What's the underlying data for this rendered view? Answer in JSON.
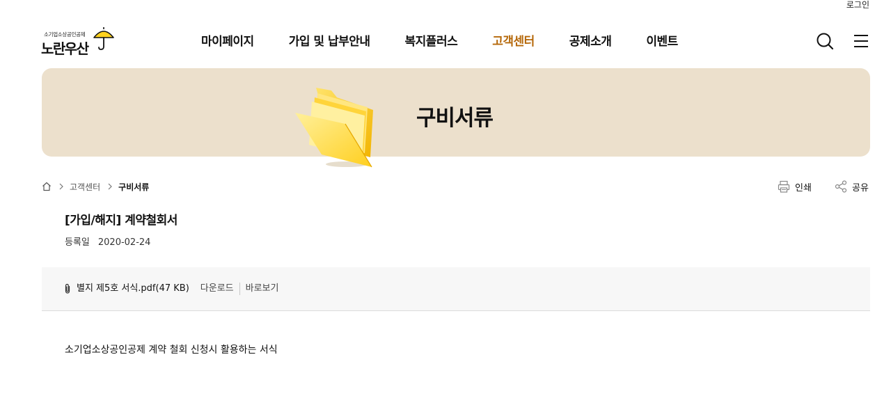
{
  "header": {
    "login_label": "로그인",
    "logo": {
      "sub": "소기업소상공인공제",
      "main": "노란우산"
    },
    "nav": [
      {
        "label": "마이페이지",
        "active": false
      },
      {
        "label": "가입 및 납부안내",
        "active": false
      },
      {
        "label": "복지플러스",
        "active": false
      },
      {
        "label": "고객센터",
        "active": true
      },
      {
        "label": "공제소개",
        "active": false
      },
      {
        "label": "이벤트",
        "active": false
      }
    ],
    "icons": [
      "search-icon",
      "menu-icon"
    ],
    "active_color": "#b5680a"
  },
  "banner": {
    "title": "구비서류",
    "background": "#ece0cc",
    "illustration": "folder-icon"
  },
  "breadcrumb": {
    "home_icon": "home-icon",
    "items": [
      "고객센터",
      "구비서류"
    ]
  },
  "utility": {
    "print_label": "인쇄",
    "share_label": "공유"
  },
  "document": {
    "title": "[가입/해지] 계약철회서",
    "meta_label": "등록일",
    "meta_date": "2020-02-24",
    "attachment": {
      "name": "별지 제5호 서식.pdf(47 KB)",
      "download_label": "다운로드",
      "view_label": "바로보기"
    },
    "body": "소기업소상공인공제 계약 철회 신청시 활용하는 서식"
  }
}
